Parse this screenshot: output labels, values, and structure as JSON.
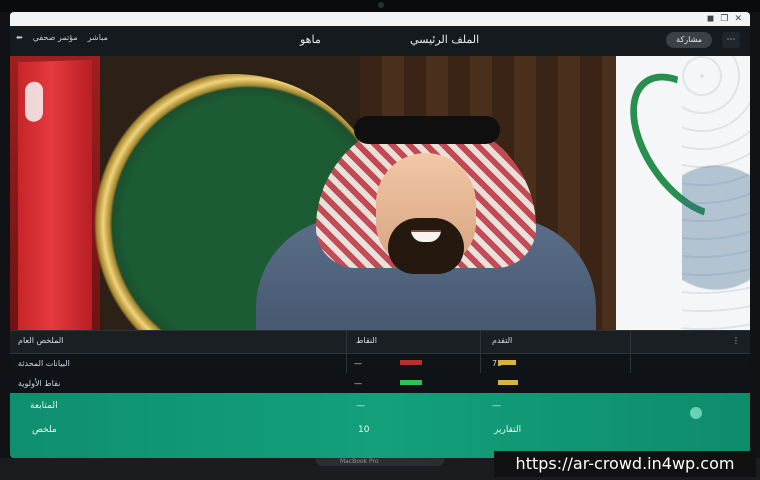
{
  "window": {
    "controls": [
      "◼",
      "❐",
      "✕"
    ]
  },
  "navbar": {
    "left_items": [
      "⬅",
      "مؤتمر صحفي",
      "مباشر"
    ],
    "title_primary": "ماهو",
    "title_secondary": "الملف الرئيسي",
    "right_pill": "مشاركة",
    "right_icon": "⋯"
  },
  "dashboard": {
    "header": {
      "col1": "الملخص العام",
      "col2": "النقاط",
      "col3": "التقدم"
    },
    "rows": [
      {
        "left": "البيانات المحدثة",
        "mid_value": "—",
        "right_value": "75",
        "bar_color": "#d9b340"
      },
      {
        "left": "نقاط الأولوية",
        "mid_value": "—",
        "right_value": "",
        "bar_color": "#d9b340"
      }
    ],
    "green_band": {
      "left_label": "المتابعة",
      "mid_label": "—",
      "right_label": "—",
      "bottom_left": "ملخص",
      "bottom_mid": "10",
      "bottom_right": "التقارير"
    }
  },
  "watermark": {
    "text": "https://ar-crowd.in4wp.com"
  },
  "device": {
    "hinge_label": "MacBook Pro"
  },
  "colors": {
    "accent_green": "#13a07b",
    "dark": "#111417",
    "gold": "#d9b340"
  }
}
